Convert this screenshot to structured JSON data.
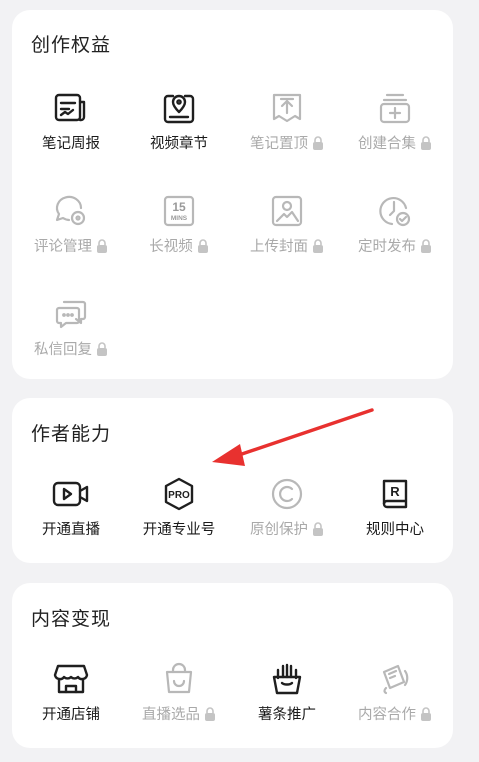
{
  "colors": {
    "background": "#f2f2f4",
    "card": "#ffffff",
    "active_icon": "#1f1f1f",
    "disabled": "#b8b8b8",
    "arrow": "#e8312f"
  },
  "sections": [
    {
      "title": "创作权益",
      "items": [
        {
          "label": "笔记周报",
          "icon": "report-icon",
          "locked": false
        },
        {
          "label": "视频章节",
          "icon": "video-chapter-icon",
          "locked": false
        },
        {
          "label": "笔记置顶",
          "icon": "pin-top-icon",
          "locked": true
        },
        {
          "label": "创建合集",
          "icon": "collection-add-icon",
          "locked": true
        },
        {
          "label": "评论管理",
          "icon": "comment-manage-icon",
          "locked": true
        },
        {
          "label": "长视频",
          "icon": "long-video-icon",
          "icon_text": "15\nMINS",
          "locked": true
        },
        {
          "label": "上传封面",
          "icon": "image-upload-icon",
          "locked": true
        },
        {
          "label": "定时发布",
          "icon": "scheduled-publish-icon",
          "locked": true
        },
        {
          "label": "私信回复",
          "icon": "message-reply-icon",
          "locked": true
        }
      ]
    },
    {
      "title": "作者能力",
      "items": [
        {
          "label": "开通直播",
          "icon": "live-camera-icon",
          "locked": false
        },
        {
          "label": "开通专业号",
          "icon": "pro-badge-icon",
          "icon_text": "PRO",
          "locked": false
        },
        {
          "label": "原创保护",
          "icon": "copyright-icon",
          "locked": true
        },
        {
          "label": "规则中心",
          "icon": "rules-book-icon",
          "icon_text": "R",
          "locked": false
        }
      ]
    },
    {
      "title": "内容变现",
      "items": [
        {
          "label": "开通店铺",
          "icon": "store-icon",
          "locked": false
        },
        {
          "label": "直播选品",
          "icon": "shopping-bag-icon",
          "locked": true
        },
        {
          "label": "薯条推广",
          "icon": "fries-icon",
          "locked": false
        },
        {
          "label": "内容合作",
          "icon": "cooperation-icon",
          "locked": true
        }
      ]
    }
  ]
}
